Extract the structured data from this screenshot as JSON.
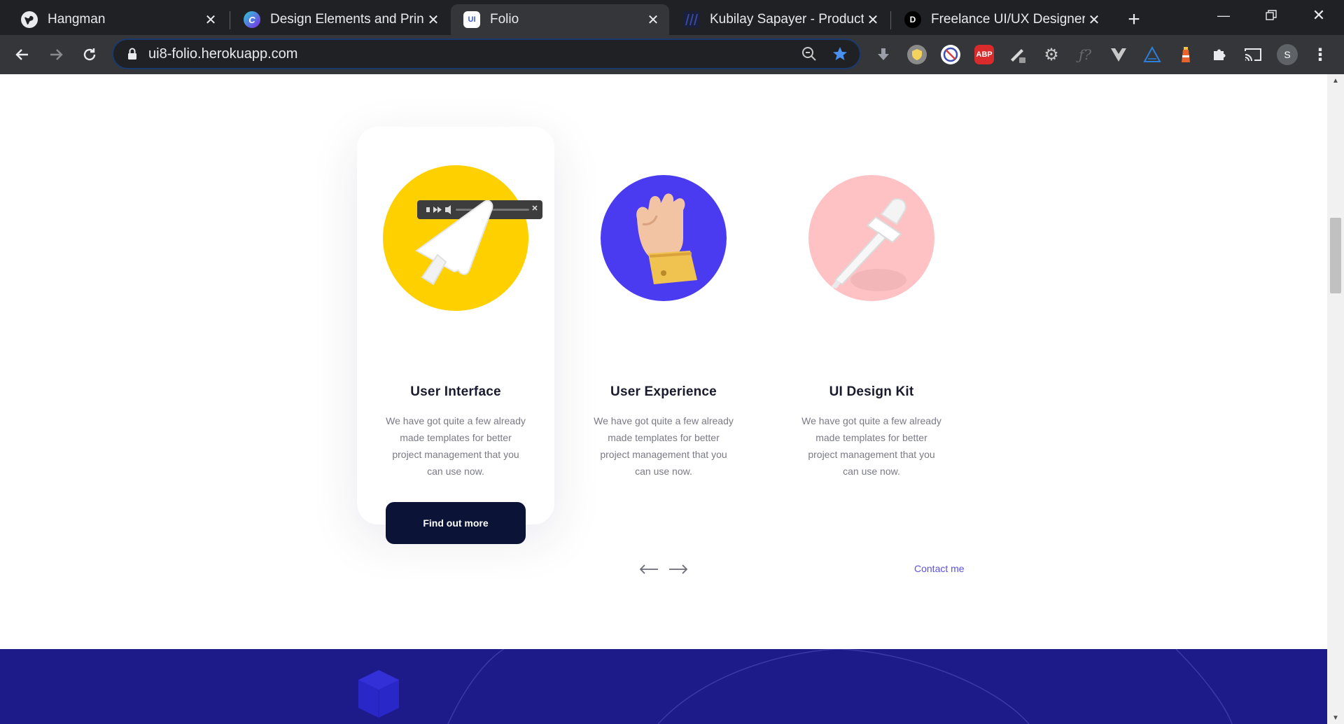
{
  "browser": {
    "tabs": [
      {
        "title": "Hangman",
        "favicon": "globe-icon"
      },
      {
        "title": "Design Elements and Princip",
        "favicon": "canva-icon"
      },
      {
        "title": "Folio",
        "favicon": "ui8-icon",
        "active": true
      },
      {
        "title": "Kubilay Sapayer - Product D",
        "favicon": "kubilay-icon"
      },
      {
        "title": "Freelance UI/UX Designer -",
        "favicon": "d-icon"
      }
    ],
    "favicon_letters": {
      "canva": "C",
      "ui8": "UI",
      "d": "D"
    },
    "url": "ui8-folio.herokuapp.com",
    "profile_initial": "S",
    "abp_label": "ABP"
  },
  "services": [
    {
      "title": "User Interface",
      "description": "We have got quite a few already made templates for better project management that you can use now.",
      "circle_color": "#FFD000"
    },
    {
      "title": "User Experience",
      "description": "We have got quite a few already made templates for better project management that you can use now.",
      "circle_color": "#4A3AF0"
    },
    {
      "title": "UI Design Kit",
      "description": "We have got quite a few already made templates for better project management that you can use now.",
      "circle_color": "#FFC2C4"
    }
  ],
  "cta_label": "Find out more",
  "contact_label": "Contact me",
  "colors": {
    "accent": "#5B50E6",
    "footer": "#1D1B89",
    "button": "#0B1437"
  }
}
